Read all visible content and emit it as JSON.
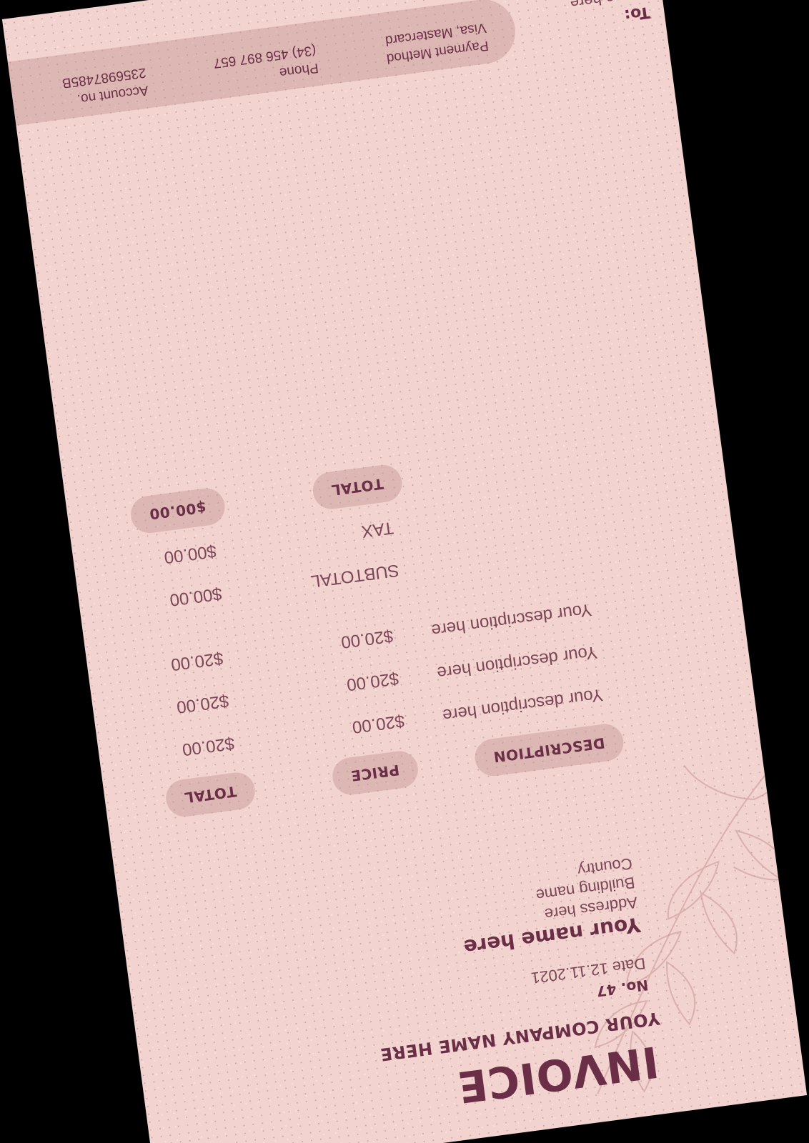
{
  "document": {
    "title": "INVOICE",
    "company": "YOUR COMPANY NAME HERE",
    "invoice_no": "No. 47",
    "date": "Date 12.11.2021"
  },
  "from": {
    "name": "Your name here",
    "address": "Address here",
    "building": "Building name",
    "country": "Country"
  },
  "table": {
    "headers": {
      "description": "DESCRIPTION",
      "price": "PRICE",
      "total": "TOTAL"
    },
    "rows": [
      {
        "description": "Your description here",
        "price": "$20.00",
        "total": "$20.00"
      },
      {
        "description": "Your description here",
        "price": "$20.00",
        "total": "$20.00"
      },
      {
        "description": "Your description here",
        "price": "$20.00",
        "total": "$20.00"
      }
    ]
  },
  "summary": {
    "subtotal_label": "SUBTOTAL",
    "subtotal_value": "$00.00",
    "tax_label": "TAX",
    "tax_value": "$00.00",
    "total_label": "TOTAL",
    "total_value": "$00.00"
  },
  "payment": {
    "method_label": "Payment Method",
    "method_value": "Visa, Mastercard",
    "phone_label": "Phone",
    "phone_value": "(34) 456 897 657",
    "account_label": "Account no.",
    "account_value": "2356987485B"
  },
  "recipient": {
    "label": "To:",
    "name": "Name here"
  },
  "colors": {
    "paper": "#f2d3cf",
    "accent": "#6a2e47",
    "pill": "#d6aaa6",
    "text": "#7a4656"
  },
  "icons": [
    "leaf-branch-illustration"
  ]
}
